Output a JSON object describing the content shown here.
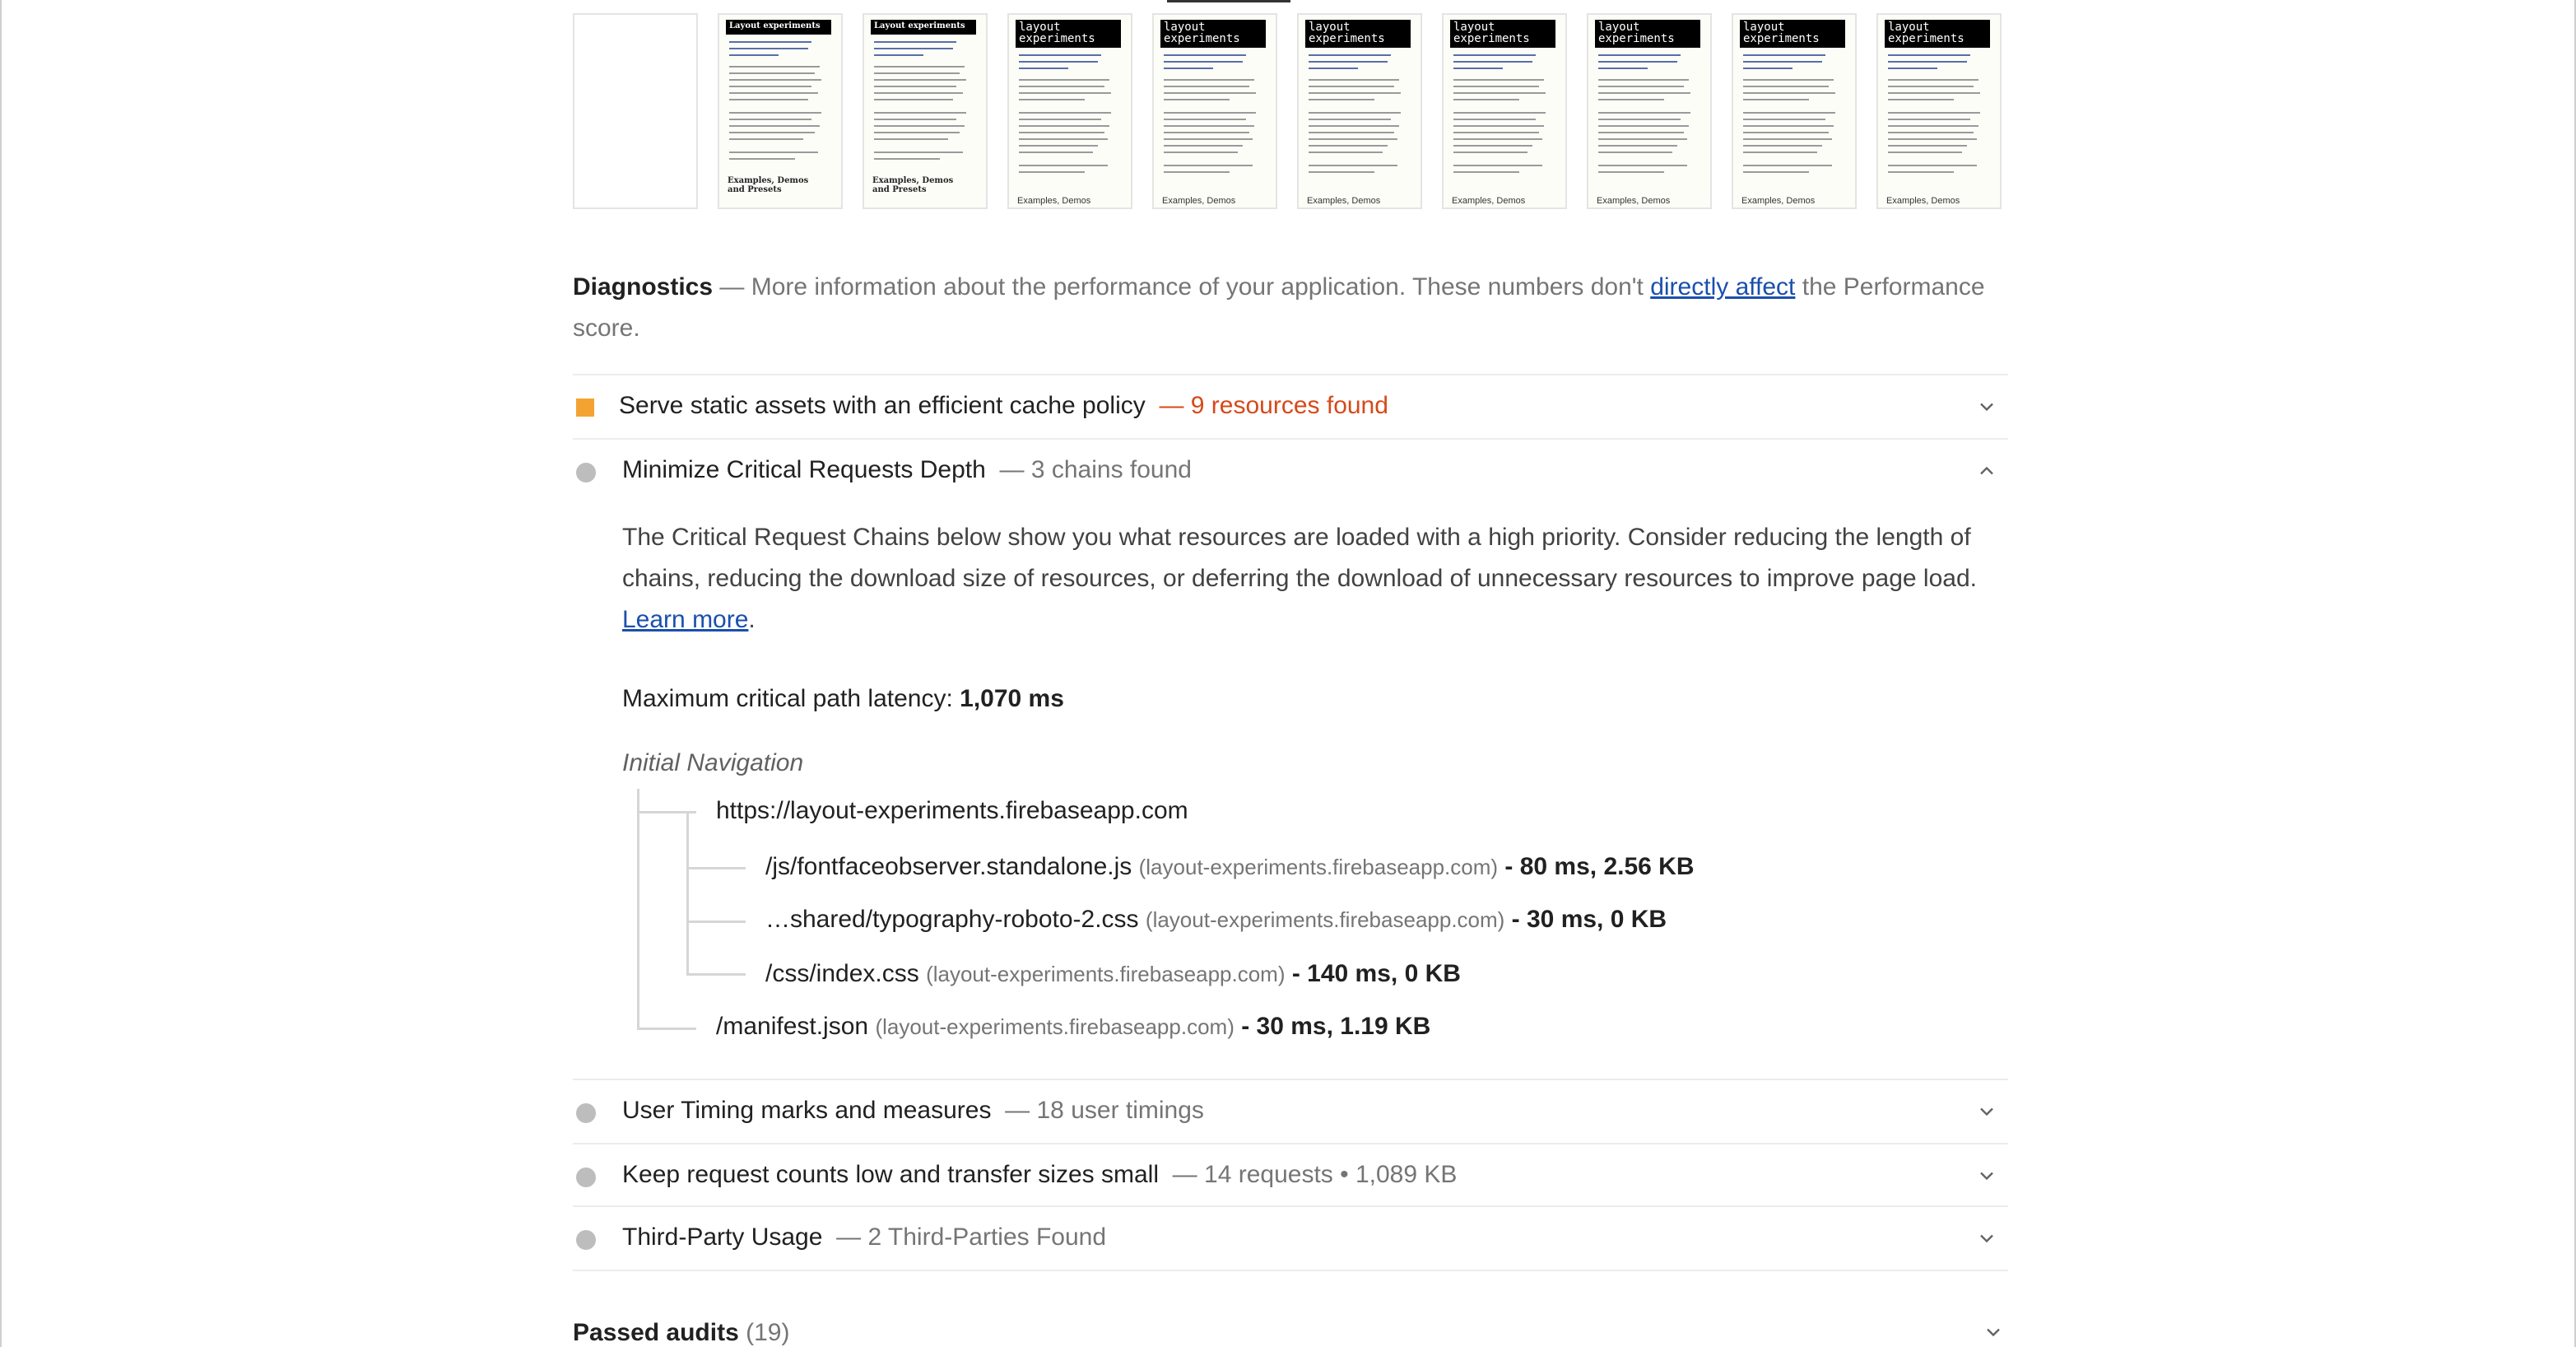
{
  "diagnostics": {
    "title": "Diagnostics",
    "dash": "—",
    "text_before": "More information about the performance of your application. These numbers don't",
    "link": "directly affect",
    "text_after": "the Performance score."
  },
  "filmstrip": {
    "frames": [
      {
        "header": "",
        "footer": ""
      },
      {
        "header": "Layout experiments",
        "footer": "Examples, Demos and Presets"
      },
      {
        "header": "Layout experiments",
        "footer": "Examples, Demos and Presets"
      },
      {
        "header": "layout experiments",
        "footer": "Examples, Demos"
      },
      {
        "header": "layout experiments",
        "footer": "Examples, Demos"
      },
      {
        "header": "layout experiments",
        "footer": "Examples, Demos"
      },
      {
        "header": "layout experiments",
        "footer": "Examples, Demos"
      },
      {
        "header": "layout experiments",
        "footer": "Examples, Demos"
      },
      {
        "header": "layout experiments",
        "footer": "Examples, Demos"
      },
      {
        "header": "layout experiments",
        "footer": "Examples, Demos"
      }
    ]
  },
  "audits": [
    {
      "title": "Serve static assets with an efficient cache policy",
      "sep": "—",
      "detail": "9 resources found",
      "status": "warn"
    },
    {
      "title": "Minimize Critical Requests Depth",
      "sep": "—",
      "detail": "3 chains found",
      "status": "info",
      "expanded": true
    },
    {
      "title": "User Timing marks and measures",
      "sep": "—",
      "detail": "18 user timings",
      "status": "info"
    },
    {
      "title": "Keep request counts low and transfer sizes small",
      "sep": "—",
      "detail": "14 requests • 1,089 KB",
      "status": "info"
    },
    {
      "title": "Third-Party Usage",
      "sep": "—",
      "detail": "2 Third-Parties Found",
      "status": "info"
    }
  ],
  "crc": {
    "description": "The Critical Request Chains below show you what resources are loaded with a high priority. Consider reducing the length of chains, reducing the download size of resources, or deferring the download of unnecessary resources to improve page load.",
    "learn_more": "Learn more",
    "period": ".",
    "latency_label": "Maximum critical path latency:",
    "latency_value": "1,070 ms",
    "initial_nav": "Initial Navigation",
    "root": "https://layout-experiments.firebaseapp.com",
    "chains": [
      {
        "url": "/js/fontfaceobserver.standalone.js",
        "host": "(layout-experiments.firebaseapp.com)",
        "stats": "- 80 ms, 2.56 KB"
      },
      {
        "url": "…shared/typography-roboto-2.css",
        "host": "(layout-experiments.firebaseapp.com)",
        "stats": "- 30 ms, 0 KB"
      },
      {
        "url": "/css/index.css",
        "host": "(layout-experiments.firebaseapp.com)",
        "stats": "- 140 ms, 0 KB"
      },
      {
        "url": "/manifest.json",
        "host": "(layout-experiments.firebaseapp.com)",
        "stats": "- 30 ms, 1.19 KB"
      }
    ]
  },
  "passed": {
    "label": "Passed audits",
    "count": "(19)"
  },
  "colors": {
    "warn": "#f4a332",
    "warn_text": "#d6491a",
    "info": "#bdbdbd",
    "link": "#1a4fae"
  },
  "icons": {
    "expand": "chevron-down-icon",
    "collapse": "chevron-up-icon",
    "warn": "orange-square-icon",
    "info": "gray-circle-icon"
  }
}
